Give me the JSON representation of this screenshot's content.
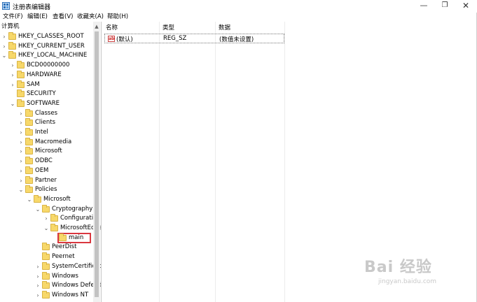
{
  "window": {
    "title": "注册表编辑器",
    "min": "—",
    "max": "❐",
    "close": "✕"
  },
  "menu": [
    "文件(F)",
    "编辑(E)",
    "查看(V)",
    "收藏夹(A)",
    "帮助(H)"
  ],
  "tree": {
    "root": "计算机",
    "rows": [
      {
        "label": "HKEY_CLASSES_ROOT",
        "exp": ">"
      },
      {
        "label": "HKEY_CURRENT_USER",
        "exp": ">"
      },
      {
        "label": "HKEY_LOCAL_MACHINE",
        "exp": "v"
      },
      {
        "label": "BCD00000000",
        "exp": ">"
      },
      {
        "label": "HARDWARE",
        "exp": ">"
      },
      {
        "label": "SAM",
        "exp": ">"
      },
      {
        "label": "SECURITY",
        "exp": ""
      },
      {
        "label": "SOFTWARE",
        "exp": "v"
      },
      {
        "label": "Classes",
        "exp": ">"
      },
      {
        "label": "Clients",
        "exp": ">"
      },
      {
        "label": "Intel",
        "exp": ">"
      },
      {
        "label": "Macromedia",
        "exp": ">"
      },
      {
        "label": "Microsoft",
        "exp": ">"
      },
      {
        "label": "ODBC",
        "exp": ">"
      },
      {
        "label": "OEM",
        "exp": ">"
      },
      {
        "label": "Partner",
        "exp": ">"
      },
      {
        "label": "Policies",
        "exp": "v"
      },
      {
        "label": "Microsoft",
        "exp": "v"
      },
      {
        "label": "Cryptography",
        "exp": "v"
      },
      {
        "label": "Configuration",
        "exp": ">"
      },
      {
        "label": "MicrosoftEdge",
        "exp": "v"
      },
      {
        "label": "main",
        "exp": ""
      },
      {
        "label": "PeerDist",
        "exp": ""
      },
      {
        "label": "Peernet",
        "exp": ""
      },
      {
        "label": "SystemCertificates",
        "exp": ">"
      },
      {
        "label": "Windows",
        "exp": ">"
      },
      {
        "label": "Windows Defender",
        "exp": ">"
      },
      {
        "label": "Windows NT",
        "exp": ">"
      }
    ]
  },
  "list": {
    "columns": [
      "名称",
      "类型",
      "数据"
    ],
    "rows": [
      {
        "name": "(默认)",
        "type": "REG_SZ",
        "data": "(数值未设置)",
        "icon": "ab"
      }
    ]
  },
  "watermark": {
    "logo": "Bai 经验",
    "url": "jingyan.baidu.com"
  }
}
